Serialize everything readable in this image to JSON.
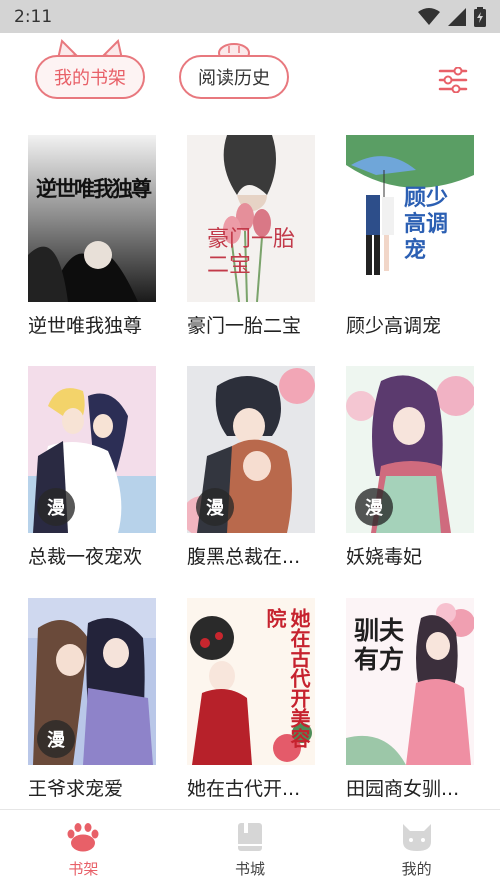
{
  "status_bar": {
    "time": "2:11"
  },
  "header": {
    "tabs": [
      {
        "label": "我的书架",
        "active": true
      },
      {
        "label": "阅读历史",
        "active": false
      }
    ]
  },
  "books": [
    {
      "title": "逆世唯我独尊",
      "cover_text": "逆世唯我独尊",
      "manga": false
    },
    {
      "title": "豪门一胎二宝",
      "cover_text": "豪门一胎二宝",
      "manga": false
    },
    {
      "title": "顾少高调宠",
      "cover_text": "顾少高调宠",
      "manga": false
    },
    {
      "title": "总裁一夜宠欢",
      "manga": true
    },
    {
      "title": "腹黑总裁在...",
      "manga": true
    },
    {
      "title": "妖娆毒妃",
      "manga": true
    },
    {
      "title": "王爷求宠爱",
      "manga": true
    },
    {
      "title": "她在古代开...",
      "cover_text": "她在古代开美容院",
      "manga": false
    },
    {
      "title": "田园商女驯...",
      "cover_text": "驯夫有方",
      "manga": false
    }
  ],
  "manga_badge": "漫",
  "bottom_nav": [
    {
      "label": "书架",
      "active": true,
      "icon": "paw-icon"
    },
    {
      "label": "书城",
      "active": false,
      "icon": "book-icon"
    },
    {
      "label": "我的",
      "active": false,
      "icon": "cat-icon"
    }
  ],
  "colors": {
    "accent": "#e86068",
    "status_bar": "#d4d4d4"
  }
}
